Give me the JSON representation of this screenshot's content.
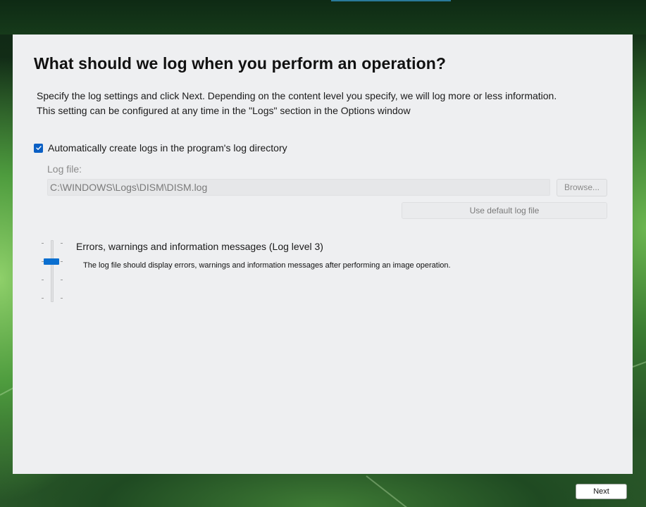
{
  "page": {
    "title": "What should we log when you perform an operation?",
    "description_line1": "Specify the log settings and click Next. Depending on the content level you specify, we will log more or less information.",
    "description_line2": "This setting can be configured at any time in the \"Logs\" section in the Options window"
  },
  "logging": {
    "auto_create_label": "Automatically create logs in the program's log directory",
    "auto_create_checked": true,
    "log_file_label": "Log file:",
    "log_file_path": "C:\\WINDOWS\\Logs\\DISM\\DISM.log",
    "browse_label": "Browse...",
    "default_button_label": "Use default log file"
  },
  "log_level": {
    "current_level": 3,
    "levels_count": 4,
    "title": "Errors, warnings and information messages (Log level 3)",
    "description": "The log file should display errors, warnings and information messages after performing an image operation."
  },
  "footer": {
    "next_label": "Next"
  },
  "colors": {
    "accent": "#0a6fd0",
    "panel_background": "#eeeff1",
    "backdrop": "#1d4421"
  },
  "icons": {
    "checkbox": "checkmark-icon"
  }
}
